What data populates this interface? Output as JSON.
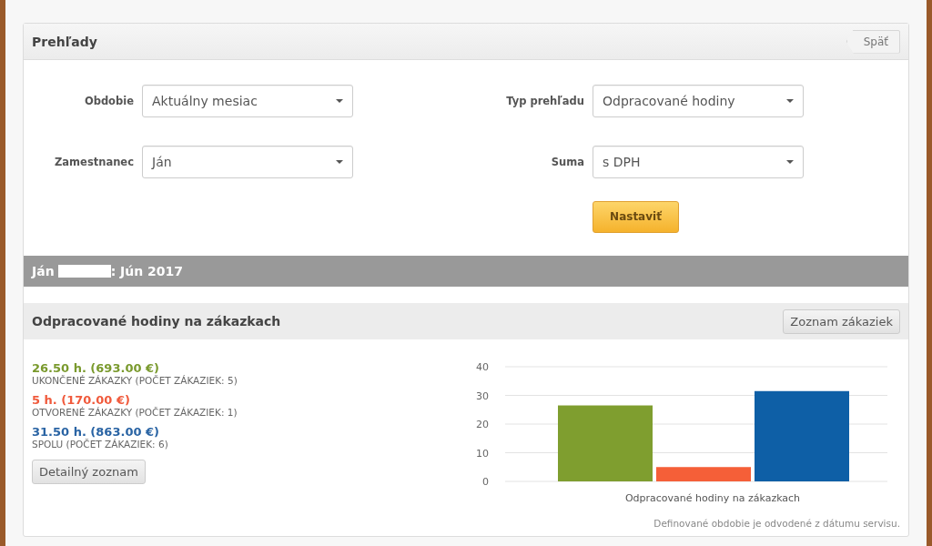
{
  "panel": {
    "title": "Prehľady",
    "back_button": "Späť"
  },
  "filters": [
    {
      "label": "Obdobie",
      "value": "Aktuálny mesiac"
    },
    {
      "label": "Typ prehľadu",
      "value": "Odpracované hodiny"
    },
    {
      "label": "Zamestnanec",
      "value": "Ján"
    },
    {
      "label": "Suma",
      "value": "s DPH"
    }
  ],
  "apply_button": "Nastaviť",
  "report_bar": {
    "name": "Ján",
    "period": ": Jún 2017"
  },
  "section": {
    "title": "Odpracované hodiny na zákazkach",
    "list_button": "Zoznam zákaziek"
  },
  "summary": [
    {
      "value": "26.50 h. (693.00 €)",
      "caption": "UKONČENÉ ZÁKAZKY (POČET ZÁKAZIEK: 5)",
      "color": "#7a9a2e"
    },
    {
      "value": "5 h. (170.00 €)",
      "caption": "OTVORENÉ ZÁKAZKY (POČET ZÁKAZIEK: 1)",
      "color": "#f05a3c"
    },
    {
      "value": "31.50 h. (863.00 €)",
      "caption": "SPOLU (POČET ZÁKAZIEK: 6)",
      "color": "#2a64a4"
    }
  ],
  "detail_button": "Detailný zoznam",
  "chart_data": {
    "type": "bar",
    "categories": [
      "Odpracované hodiny na zákazkach"
    ],
    "series": [
      {
        "color": "#7f9e2f",
        "values": [
          26.5
        ]
      },
      {
        "color": "#f55f38",
        "values": [
          5
        ]
      },
      {
        "color": "#0e5fa6",
        "values": [
          31.5
        ]
      }
    ],
    "ylim": [
      0,
      40
    ],
    "yticks": [
      0,
      10,
      20,
      30,
      40
    ],
    "grid": true
  },
  "note": "Definované obdobie je odvodené z dátumu servisu."
}
